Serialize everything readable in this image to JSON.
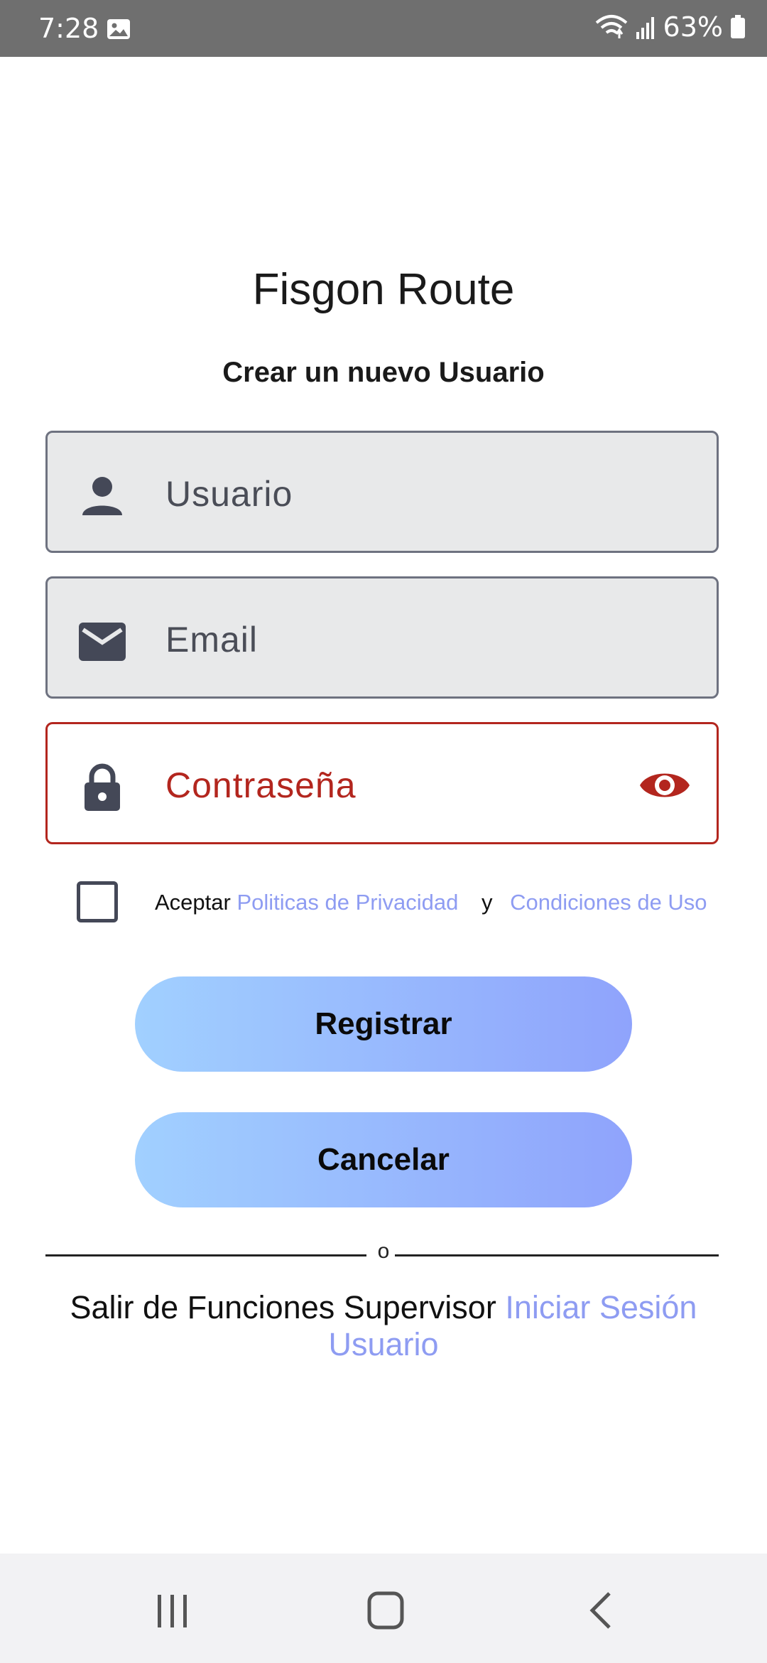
{
  "status_bar": {
    "time": "7:28",
    "battery": "63%",
    "icons": [
      "gallery-icon",
      "wifi-icon",
      "signal-icon",
      "battery-icon"
    ]
  },
  "app": {
    "title": "Fisgon Route",
    "subtitle": "Crear un nuevo Usuario"
  },
  "form": {
    "username": {
      "placeholder": "Usuario",
      "value": "",
      "icon": "person-icon"
    },
    "email": {
      "placeholder": "Email",
      "value": "",
      "icon": "mail-icon"
    },
    "password": {
      "placeholder": "Contraseña",
      "value": "",
      "icon": "lock-icon",
      "toggle_icon": "eye-icon",
      "state": "error"
    }
  },
  "terms": {
    "checked": false,
    "prefix": "Aceptar",
    "privacy_link": "Politicas de Privacidad",
    "conjunction": "y",
    "conditions_link": "Condiciones de Uso"
  },
  "buttons": {
    "register": "Registrar",
    "cancel": "Cancelar"
  },
  "divider": {
    "label": "o"
  },
  "footer": {
    "text": "Salir de Funciones Supervisor",
    "link": "Iniciar Sesión Usuario"
  },
  "nav_bar": {
    "icons": [
      "recent-apps-icon",
      "home-icon",
      "back-icon"
    ]
  },
  "colors": {
    "error": "#b3261e",
    "link": "#8e9cf2",
    "button_gradient_start": "#a1d0ff",
    "button_gradient_end": "#8fa3fc",
    "field_background": "#e8e9ea",
    "status_bar": "#6f6f6f"
  }
}
